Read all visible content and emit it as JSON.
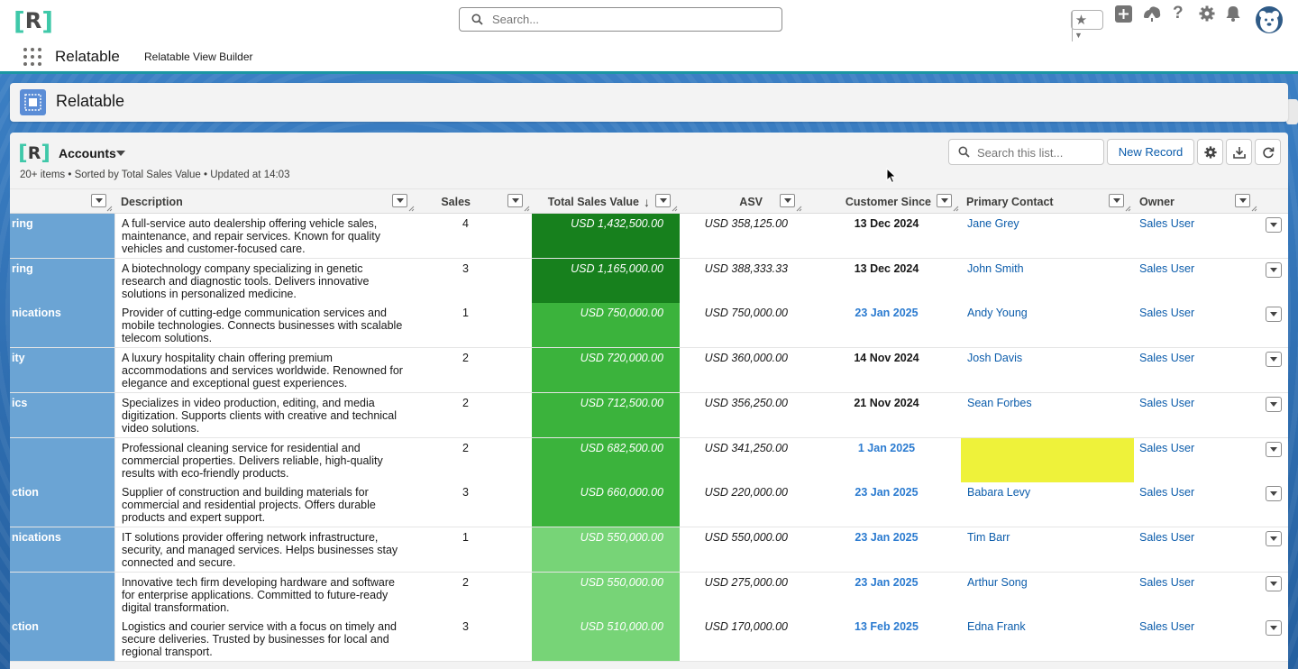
{
  "global_header": {
    "search_placeholder": "Search...",
    "icons": [
      "favorites-star-icon",
      "add-icon",
      "trailhead-icon",
      "help-icon",
      "setup-gear-icon",
      "notifications-bell-icon",
      "avatar"
    ]
  },
  "nav": {
    "app_name": "Relatable",
    "items": [
      {
        "label": "Relatable View Builder"
      }
    ]
  },
  "page_header": {
    "title": "Relatable"
  },
  "list": {
    "object_name": "Accounts",
    "meta": "20+ items • Sorted by Total Sales Value • Updated at 14:03",
    "search_placeholder": "Search this list...",
    "new_record_label": "New Record",
    "columns": [
      {
        "label": ""
      },
      {
        "label": "Description"
      },
      {
        "label": "Sales"
      },
      {
        "label": "Total Sales Value"
      },
      {
        "label": "ASV"
      },
      {
        "label": "Customer Since"
      },
      {
        "label": "Primary Contact"
      },
      {
        "label": "Owner"
      }
    ],
    "sort_indicator": "↓",
    "rows": [
      {
        "industry": "ring",
        "description": "A full-service auto dealership offering vehicle sales, maintenance, and repair services. Known for quality vehicles and customer-focused care.",
        "sales": "4",
        "tsv": "USD 1,432,500.00",
        "asv": "USD 358,125.00",
        "since": "13 Dec 2024",
        "since_color": "#181818",
        "contact": "Jane Grey",
        "owner": "Sales User",
        "tsv_bg": "#17801d"
      },
      {
        "industry": "ring",
        "description": "A biotechnology company specializing in genetic research and diagnostic tools. Delivers innovative solutions in personalized medicine.",
        "sales": "3",
        "tsv": "USD 1,165,000.00",
        "asv": "USD 388,333.33",
        "since": "13 Dec 2024",
        "since_color": "#181818",
        "contact": "John Smith",
        "owner": "Sales User",
        "tsv_bg": "#17801d"
      },
      {
        "industry": "nications",
        "description": "Provider of cutting-edge communication services and mobile technologies. Connects businesses with scalable telecom solutions.",
        "sales": "1",
        "tsv": "USD 750,000.00",
        "asv": "USD 750,000.00",
        "since": "23 Jan 2025",
        "since_color": "#2b7bd0",
        "contact": "Andy Young",
        "owner": "Sales User",
        "tsv_bg": "#3bb33c"
      },
      {
        "industry": "ity",
        "description": "A luxury hospitality chain offering premium accommodations and services worldwide. Renowned for elegance and exceptional guest experiences.",
        "sales": "2",
        "tsv": "USD 720,000.00",
        "asv": "USD 360,000.00",
        "since": "14 Nov 2024",
        "since_color": "#181818",
        "contact": "Josh Davis",
        "owner": "Sales User",
        "tsv_bg": "#3bb33c"
      },
      {
        "industry": "ics",
        "description": "Specializes in video production, editing, and media digitization. Supports clients with creative and technical video solutions.",
        "sales": "2",
        "tsv": "USD 712,500.00",
        "asv": "USD 356,250.00",
        "since": "21 Nov 2024",
        "since_color": "#181818",
        "contact": "Sean Forbes",
        "owner": "Sales User",
        "tsv_bg": "#3bb33c"
      },
      {
        "industry": "",
        "description": "Professional cleaning service for residential and commercial properties. Delivers reliable, high-quality results with eco-friendly products.",
        "sales": "2",
        "tsv": "USD 682,500.00",
        "asv": "USD 341,250.00",
        "since": "1 Jan 2025",
        "since_color": "#2b7bd0",
        "contact": "",
        "contact_bg": "#eef23a",
        "owner": "Sales User",
        "tsv_bg": "#3bb33c"
      },
      {
        "industry": "ction",
        "description": "Supplier of construction and building materials for commercial and residential projects. Offers durable products and expert support.",
        "sales": "3",
        "tsv": "USD 660,000.00",
        "asv": "USD 220,000.00",
        "since": "23 Jan 2025",
        "since_color": "#2b7bd0",
        "contact": "Babara Levy",
        "owner": "Sales User",
        "tsv_bg": "#3bb33c"
      },
      {
        "industry": "nications",
        "description": "IT solutions provider offering network infrastructure, security, and managed services. Helps businesses stay connected and secure.",
        "sales": "1",
        "tsv": "USD 550,000.00",
        "asv": "USD 550,000.00",
        "since": "23 Jan 2025",
        "since_color": "#2b7bd0",
        "contact": "Tim Barr",
        "owner": "Sales User",
        "tsv_bg": "#77d477"
      },
      {
        "industry": "",
        "description": "Innovative tech firm developing hardware and software for enterprise applications. Committed to future-ready digital transformation.",
        "sales": "2",
        "tsv": "USD 550,000.00",
        "asv": "USD 275,000.00",
        "since": "23 Jan 2025",
        "since_color": "#2b7bd0",
        "contact": "Arthur Song",
        "owner": "Sales User",
        "tsv_bg": "#77d477"
      },
      {
        "industry": "ction",
        "description": "Logistics and courier service with a focus on timely and secure deliveries. Trusted by businesses for local and regional transport.",
        "sales": "3",
        "tsv": "USD 510,000.00",
        "asv": "USD 170,000.00",
        "since": "13 Feb 2025",
        "since_color": "#2b7bd0",
        "contact": "Edna Frank",
        "owner": "Sales User",
        "tsv_bg": "#77d477"
      }
    ]
  }
}
